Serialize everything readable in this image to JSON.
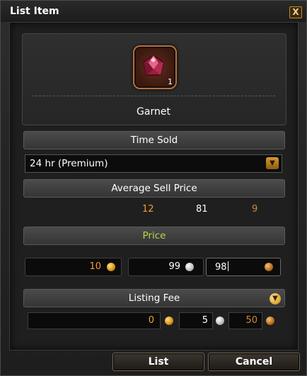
{
  "window": {
    "title": "List Item",
    "close_glyph": "X"
  },
  "item": {
    "name": "Garnet",
    "quantity": "1",
    "icon": "garnet-gem-icon"
  },
  "time_sold": {
    "label": "Time Sold",
    "selected": "24 hr (Premium)"
  },
  "average_sell_price": {
    "label": "Average Sell Price",
    "gold": "12",
    "silver": "81",
    "copper": "9"
  },
  "price": {
    "label": "Price",
    "gold": "10",
    "silver": "99",
    "copper": "98"
  },
  "listing_fee": {
    "label": "Listing Fee",
    "gold": "0",
    "silver": "5",
    "copper": "50"
  },
  "buttons": {
    "list": "List",
    "cancel": "Cancel"
  },
  "colors": {
    "gold_text": "#f0a030",
    "green_label": "#b6d64a",
    "copper_text": "#d08a3a"
  }
}
